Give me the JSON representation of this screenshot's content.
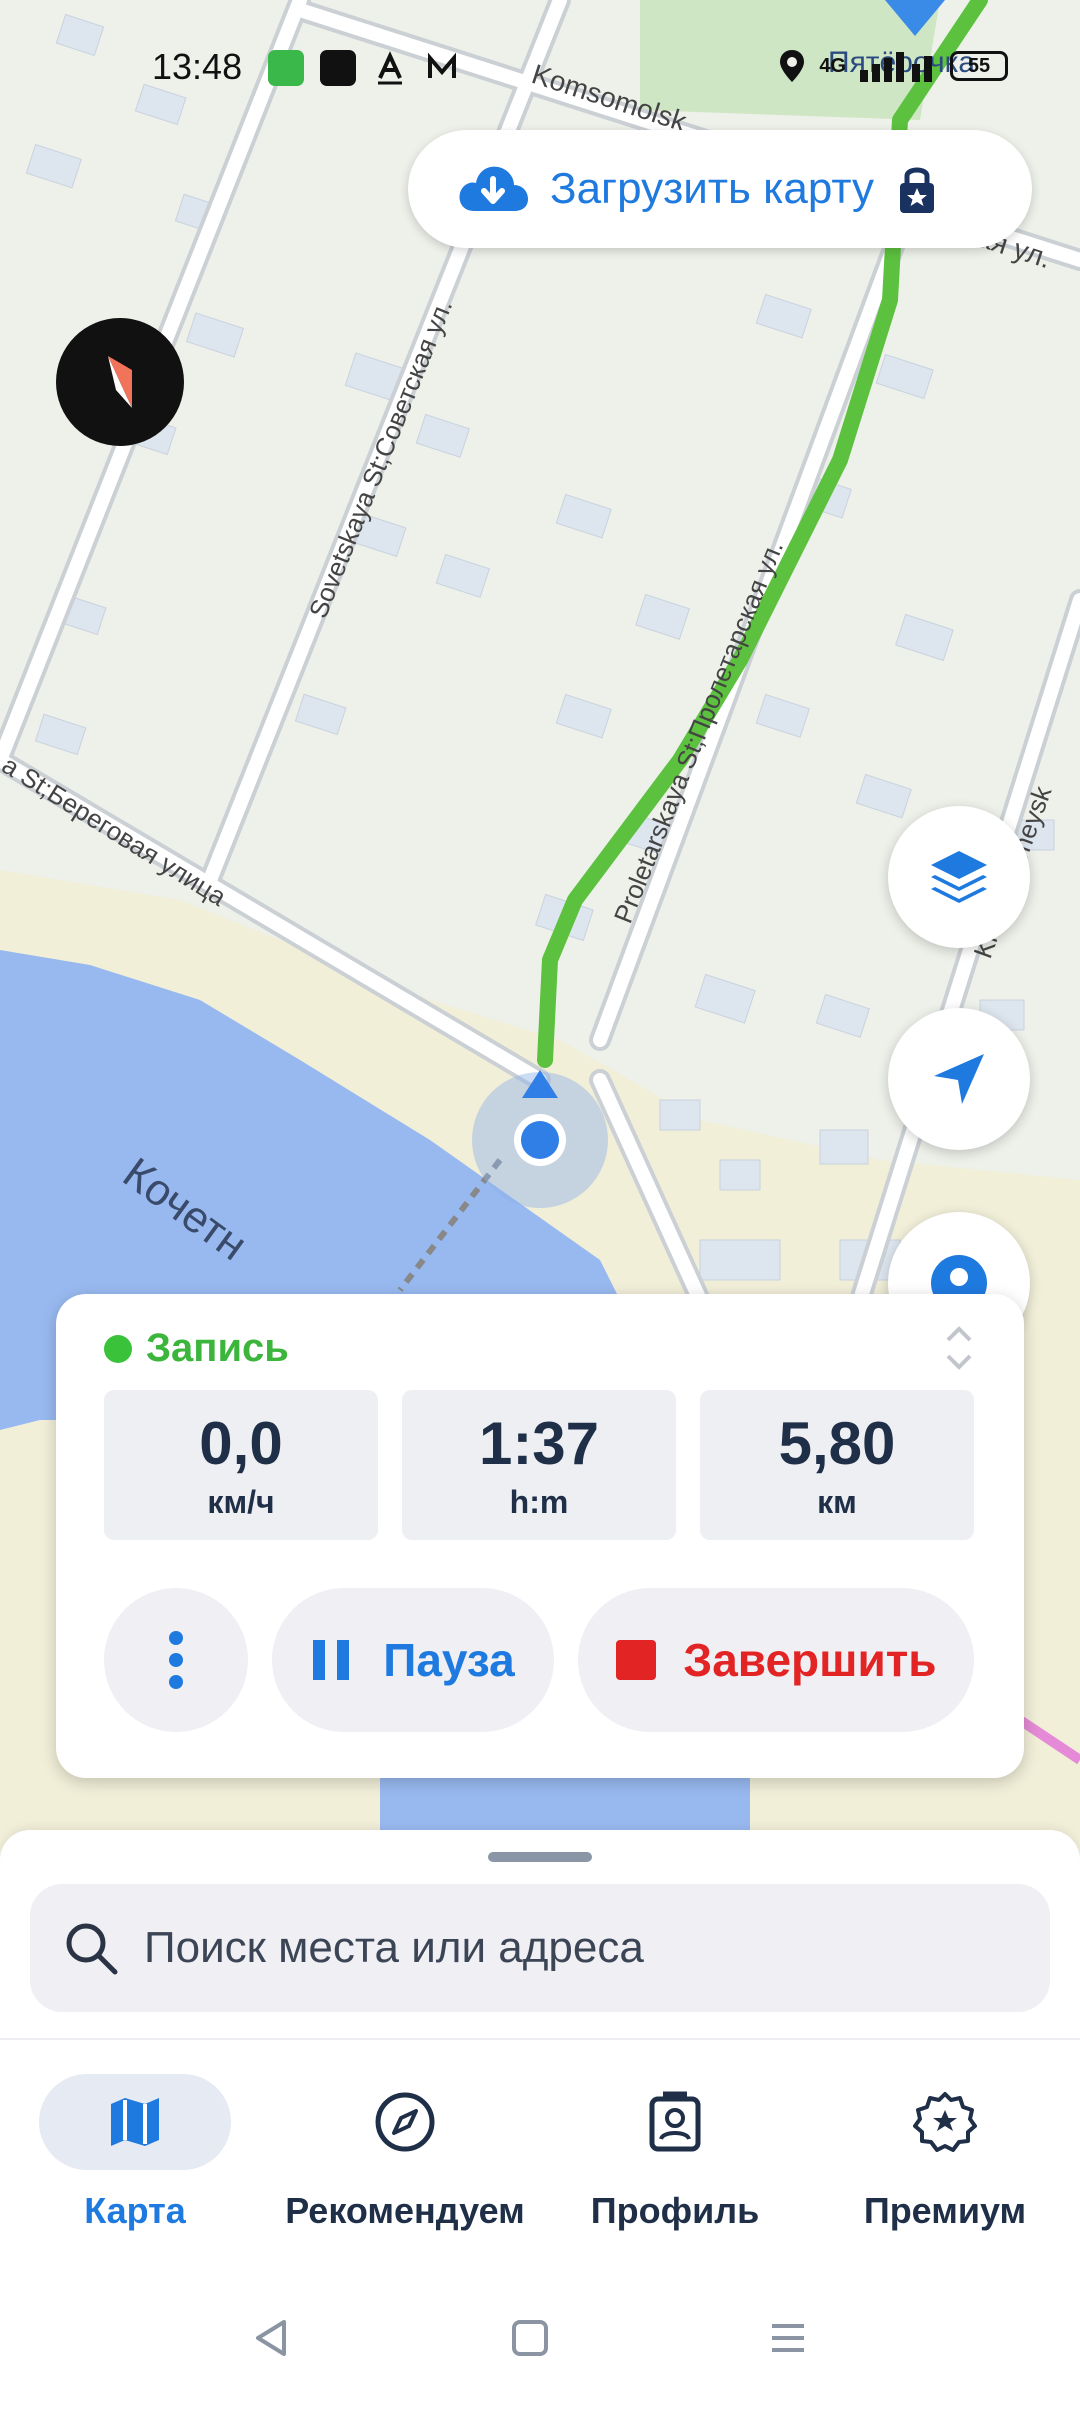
{
  "status_bar": {
    "time": "13:48",
    "network": "4G",
    "battery": "55",
    "notification_icons": [
      "messages-icon",
      "dark-app-icon",
      "a-app-icon",
      "m-app-icon"
    ]
  },
  "map": {
    "labels": {
      "komsomolskaya": "Komsomolsk",
      "pyaterochka": "Пятёрочка",
      "sovetskaya": "Sovetskaya St;Советская ул.",
      "proletarskaya": "Proletarskaya St;Пролетарская ул.",
      "beregovaya": "a St;Береговая улица",
      "krasnoarmeyskaya": "Krasnoarmeysk",
      "kochetny": "Кочетн",
      "ul_top_right": "ая ул."
    },
    "route_color": "#5cc13e",
    "water_color": "#98b9f0"
  },
  "download_map": {
    "label": "Загрузить карту"
  },
  "recording": {
    "status_label": "Запись",
    "stats": [
      {
        "value": "0,0",
        "unit": "км/ч"
      },
      {
        "value": "1:37",
        "unit": "h:m"
      },
      {
        "value": "5,80",
        "unit": "км"
      }
    ],
    "pause_label": "Пауза",
    "finish_label": "Завершить",
    "accent_blue": "#1f7ae0",
    "accent_red": "#e32424"
  },
  "search": {
    "placeholder": "Поиск места или адреса"
  },
  "bottom_nav": [
    {
      "label": "Карта",
      "icon": "map-icon",
      "active": true
    },
    {
      "label": "Рекомендуем",
      "icon": "compass-icon",
      "active": false
    },
    {
      "label": "Профиль",
      "icon": "profile-icon",
      "active": false
    },
    {
      "label": "Премиум",
      "icon": "premium-star-icon",
      "active": false
    }
  ]
}
